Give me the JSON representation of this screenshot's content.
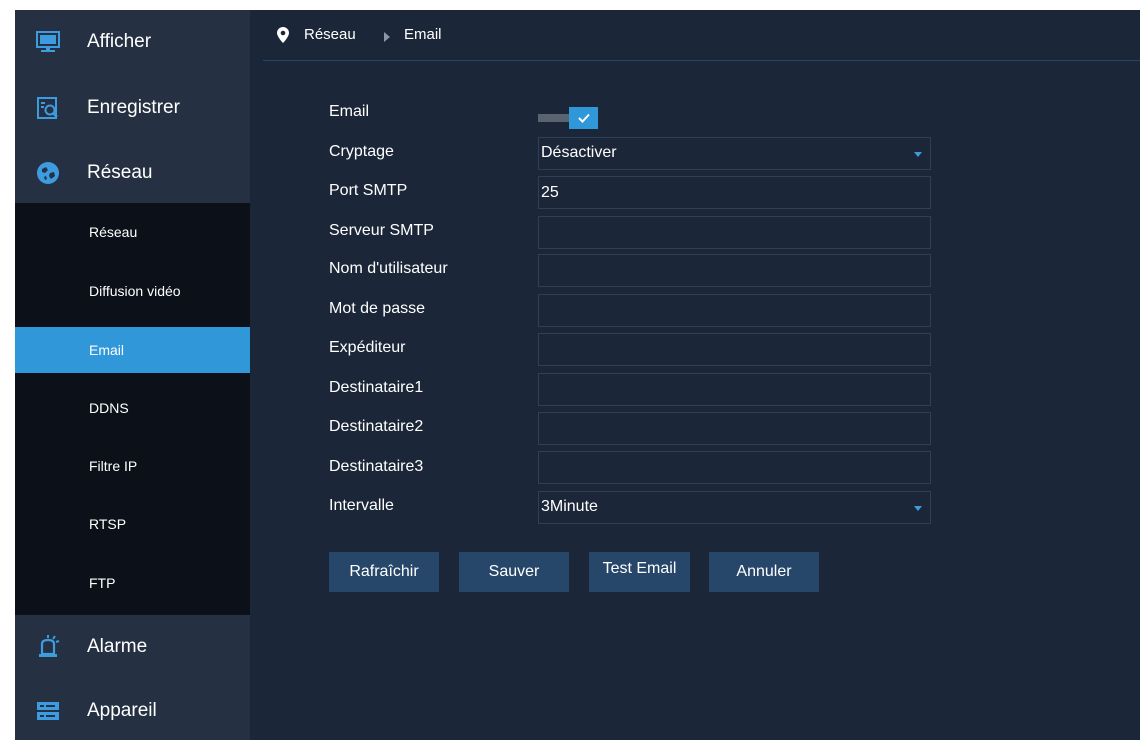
{
  "sidebar": {
    "items": [
      {
        "label": "Afficher",
        "icon": "monitor-icon"
      },
      {
        "label": "Enregistrer",
        "icon": "record-search-icon"
      },
      {
        "label": "Réseau",
        "icon": "network-globe-icon"
      },
      {
        "label": "Alarme",
        "icon": "alarm-bell-icon"
      },
      {
        "label": "Appareil",
        "icon": "device-storage-icon"
      }
    ],
    "submenu": [
      "Réseau",
      "Diffusion vidéo",
      "Email",
      "DDNS",
      "Filtre IP",
      "RTSP",
      "FTP"
    ],
    "active_submenu": "Email"
  },
  "breadcrumb": {
    "parent": "Réseau",
    "current": "Email"
  },
  "form": {
    "email": {
      "label": "Email",
      "enabled": true
    },
    "cryptage": {
      "label": "Cryptage",
      "value": "Désactiver"
    },
    "port_smtp": {
      "label": "Port SMTP",
      "value": "25"
    },
    "serveur_smtp": {
      "label": "Serveur SMTP",
      "value": ""
    },
    "nom_utilisateur": {
      "label": "Nom d'utilisateur",
      "value": ""
    },
    "mot_de_passe": {
      "label": "Mot de passe",
      "value": ""
    },
    "expediteur": {
      "label": "Expéditeur",
      "value": ""
    },
    "destinataire1": {
      "label": "Destinataire1",
      "value": ""
    },
    "destinataire2": {
      "label": "Destinataire2",
      "value": ""
    },
    "destinataire3": {
      "label": "Destinataire3",
      "value": ""
    },
    "intervalle": {
      "label": "Intervalle",
      "value": "3Minute"
    }
  },
  "buttons": {
    "refresh": "Rafraîchir",
    "save": "Sauver",
    "test": "Test Email",
    "cancel": "Annuler"
  },
  "colors": {
    "accent": "#3097d8",
    "background": "#1b2738",
    "sidebar": "#253142",
    "submenu": "#0c1119",
    "button": "#27476a"
  }
}
